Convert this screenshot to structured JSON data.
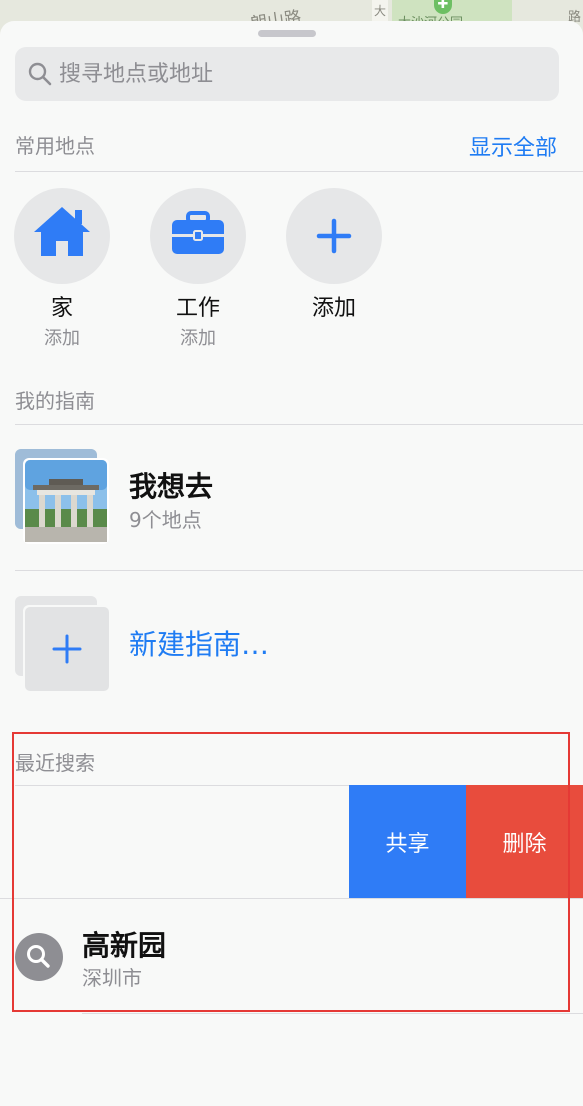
{
  "map": {
    "road_label": "朗山路",
    "side_road_label": "大",
    "park_label": "大沙河公园",
    "edge_label": "路"
  },
  "search": {
    "placeholder": "搜寻地点或地址",
    "value": ""
  },
  "favorites": {
    "header": "常用地点",
    "show_all": "显示全部",
    "items": [
      {
        "name": "家",
        "sub": "添加",
        "icon": "house-icon"
      },
      {
        "name": "工作",
        "sub": "添加",
        "icon": "briefcase-icon"
      },
      {
        "name": "添加",
        "sub": "",
        "icon": "plus-icon"
      }
    ]
  },
  "guides": {
    "header": "我的指南",
    "items": [
      {
        "title": "我想去",
        "subtitle": "9个地点"
      }
    ],
    "new_label": "新建指南…"
  },
  "recents": {
    "header": "最近搜索",
    "actions": {
      "share": "共享",
      "delete": "删除"
    },
    "items": [
      {
        "title": "高新园",
        "subtitle": "深圳市",
        "icon": "magnifier-icon"
      }
    ]
  },
  "colors": {
    "accent": "#1f7cf3",
    "share": "#2f7cf6",
    "delete": "#e84c3d",
    "highlight": "#e53935"
  }
}
